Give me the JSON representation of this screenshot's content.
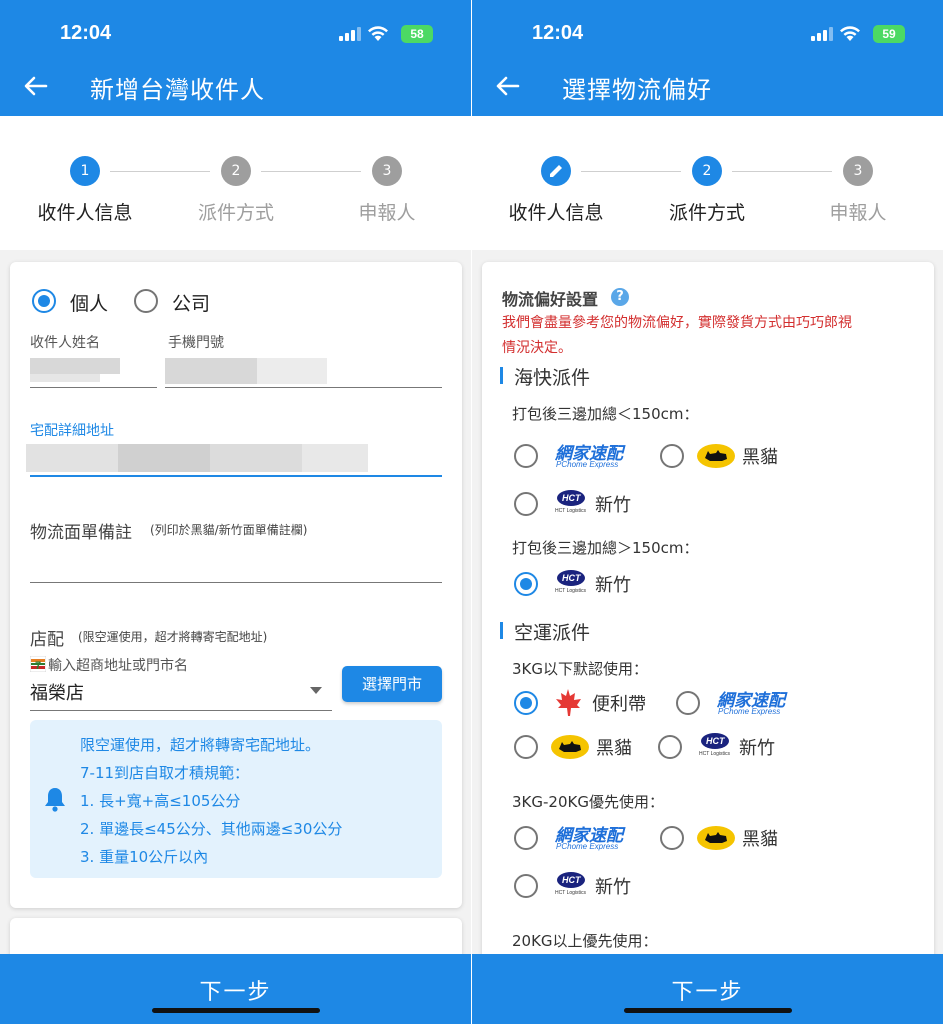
{
  "status": {
    "time": "12:04",
    "battery_left": "58",
    "battery_right": "59"
  },
  "left": {
    "title": "新增台灣收件人",
    "steps": [
      "收件人信息",
      "派件方式",
      "申報人"
    ],
    "step_numbers": [
      "1",
      "2",
      "3"
    ],
    "type_options": [
      "個人",
      "公司"
    ],
    "name_label": "收件人姓名",
    "phone_label": "手機門號",
    "address_label": "宅配詳細地址",
    "remark_label": "物流面單備註",
    "remark_hint": "(列印於黑貓/新竹面單備註欄)",
    "store_label": "店配",
    "store_hint": "(限空運使用，超才將轉寄宅配地址)",
    "store_input_label": "輸入超商地址或門市名",
    "store_value": "福榮店",
    "select_store_button": "選擇門市",
    "info_lines": [
      "限空運使用，超才將轉寄宅配地址。",
      "7-11到店自取才積規範：",
      "1. 長+寬+高≤105公分",
      "2. 單邊長≤45公分、其他兩邊≤30公分",
      "3. 重量10公斤以內"
    ],
    "next_button": "下一步"
  },
  "right": {
    "title": "選擇物流偏好",
    "steps": [
      "收件人信息",
      "派件方式",
      "申報人"
    ],
    "step_numbers": [
      "2",
      "3"
    ],
    "pref_title": "物流偏好設置",
    "pref_help": "?",
    "pref_note_1": "我們會盡量參考您的物流偏好，實際發貨方式由巧巧郎視",
    "pref_note_2": "情況決定。",
    "sea_title": "海快派件",
    "sea_rule_1": "打包後三邊加總＜150cm：",
    "sea_rule_2": "打包後三邊加總＞150cm：",
    "air_title": "空運派件",
    "air_rule_1": "3KG以下默認使用：",
    "air_rule_2": "3KG-20KG優先使用：",
    "air_rule_3": "20KG以上優先使用：",
    "pchome_logo": "網家速配",
    "pchome_sub": "PChome Express",
    "hct_logo": "HCT",
    "hct_sub": "HCT Logistics",
    "carrier_black_cat": "黑貓",
    "carrier_hct": "新竹",
    "carrier_convenience": "便利帶",
    "next_button": "下一步"
  },
  "colors": {
    "primary": "#1e88e5",
    "warning_text": "#d32f2f",
    "info_bg": "#e3f2fd"
  }
}
